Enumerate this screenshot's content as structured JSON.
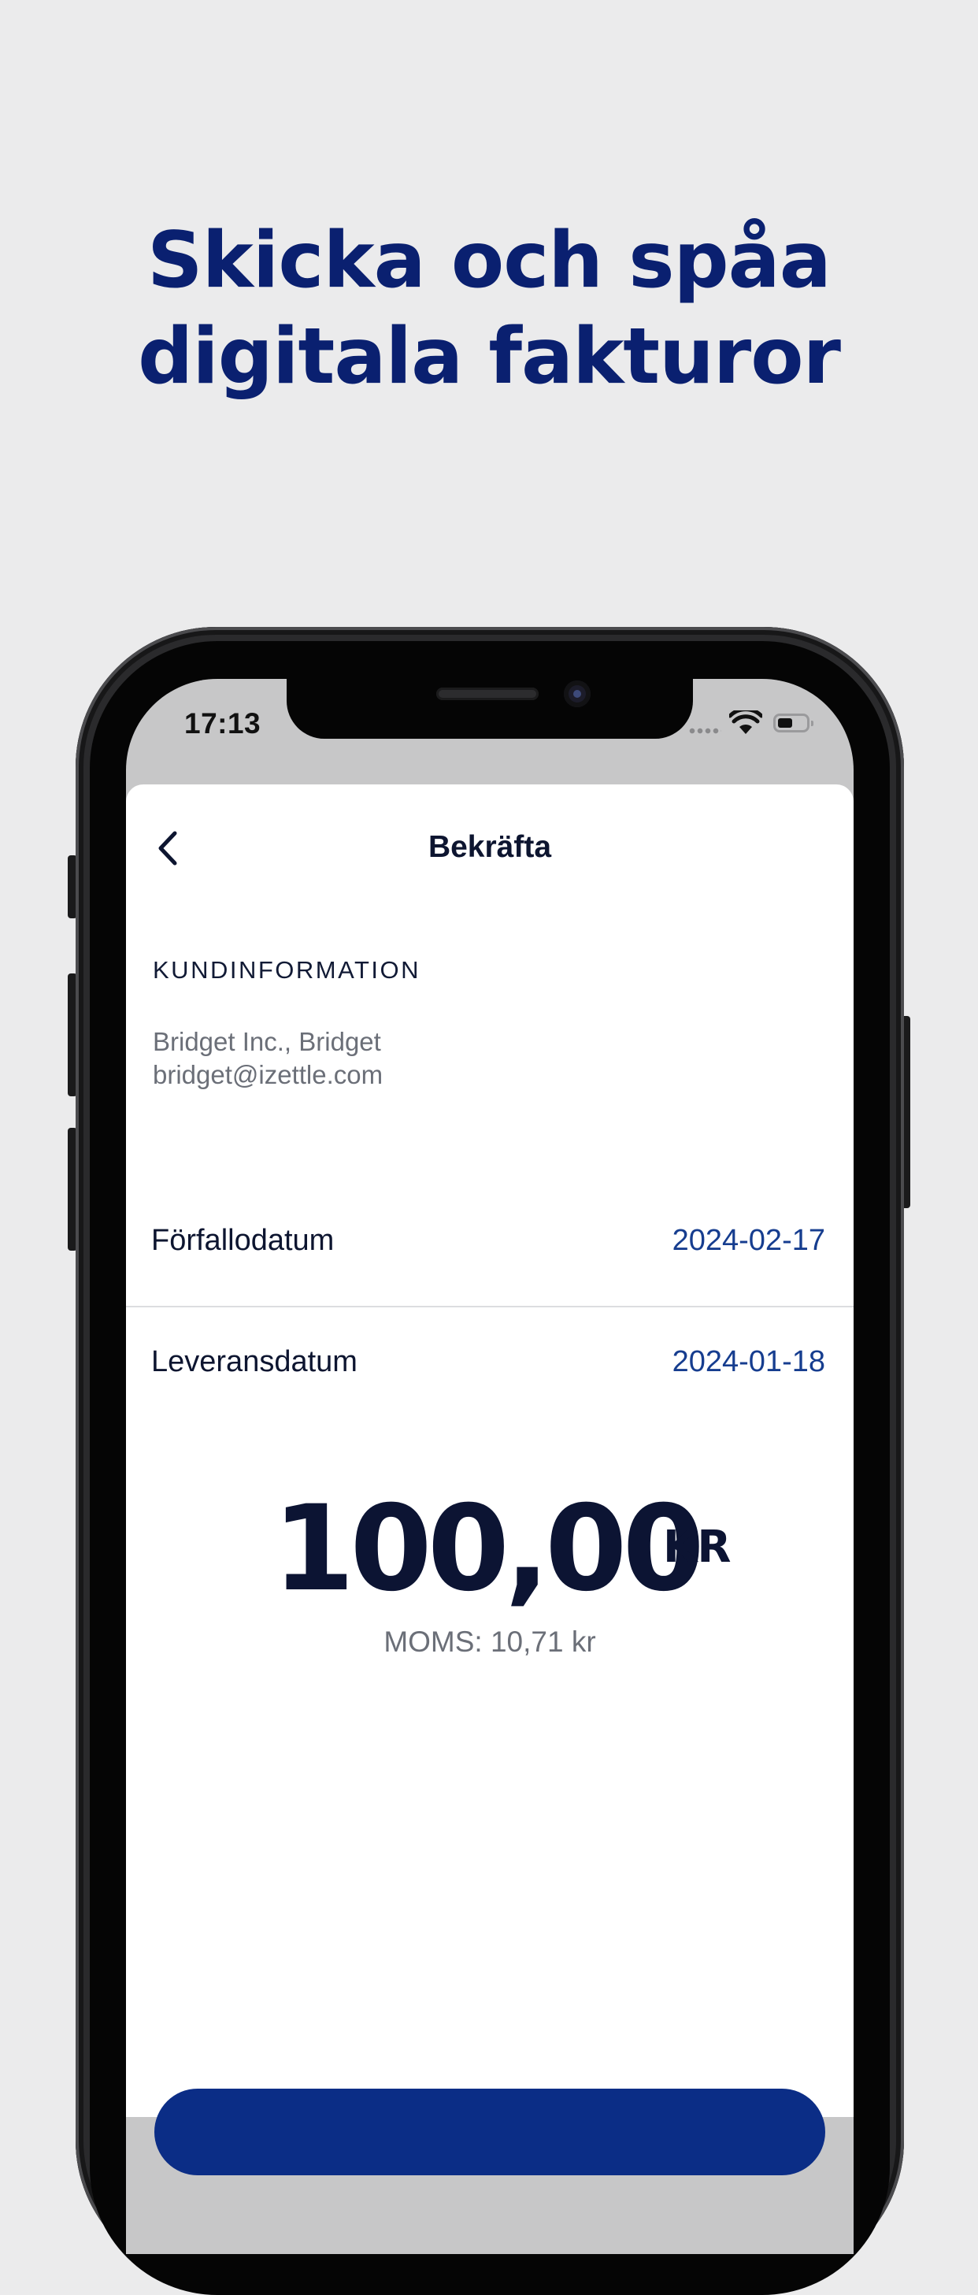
{
  "headline": {
    "line1": "Skicka och spåa",
    "line2": "digitala fakturor"
  },
  "status_bar": {
    "time": "17:13",
    "icons": [
      "signal-dots-icon",
      "wifi-icon",
      "battery-icon"
    ]
  },
  "nav": {
    "title": "Bekräfta",
    "back_icon": "chevron-left-icon"
  },
  "customer": {
    "section_label": "KUNDINFORMATION",
    "name": "Bridget Inc., Bridget",
    "email": "bridget@izettle.com"
  },
  "details": [
    {
      "label": "Förfallodatum",
      "value": "2024-02-17"
    },
    {
      "label": "Leveransdatum",
      "value": "2024-01-18"
    }
  ],
  "amount": {
    "value": "100,00",
    "currency": "KR",
    "vat": "MOMS: 10,71 kr"
  },
  "colors": {
    "background": "#ebebec",
    "headline": "#0a2070",
    "accent_value": "#163d8f",
    "primary_button": "#0b2d86",
    "text_dark": "#0d1530",
    "text_muted": "#6b6f78"
  }
}
